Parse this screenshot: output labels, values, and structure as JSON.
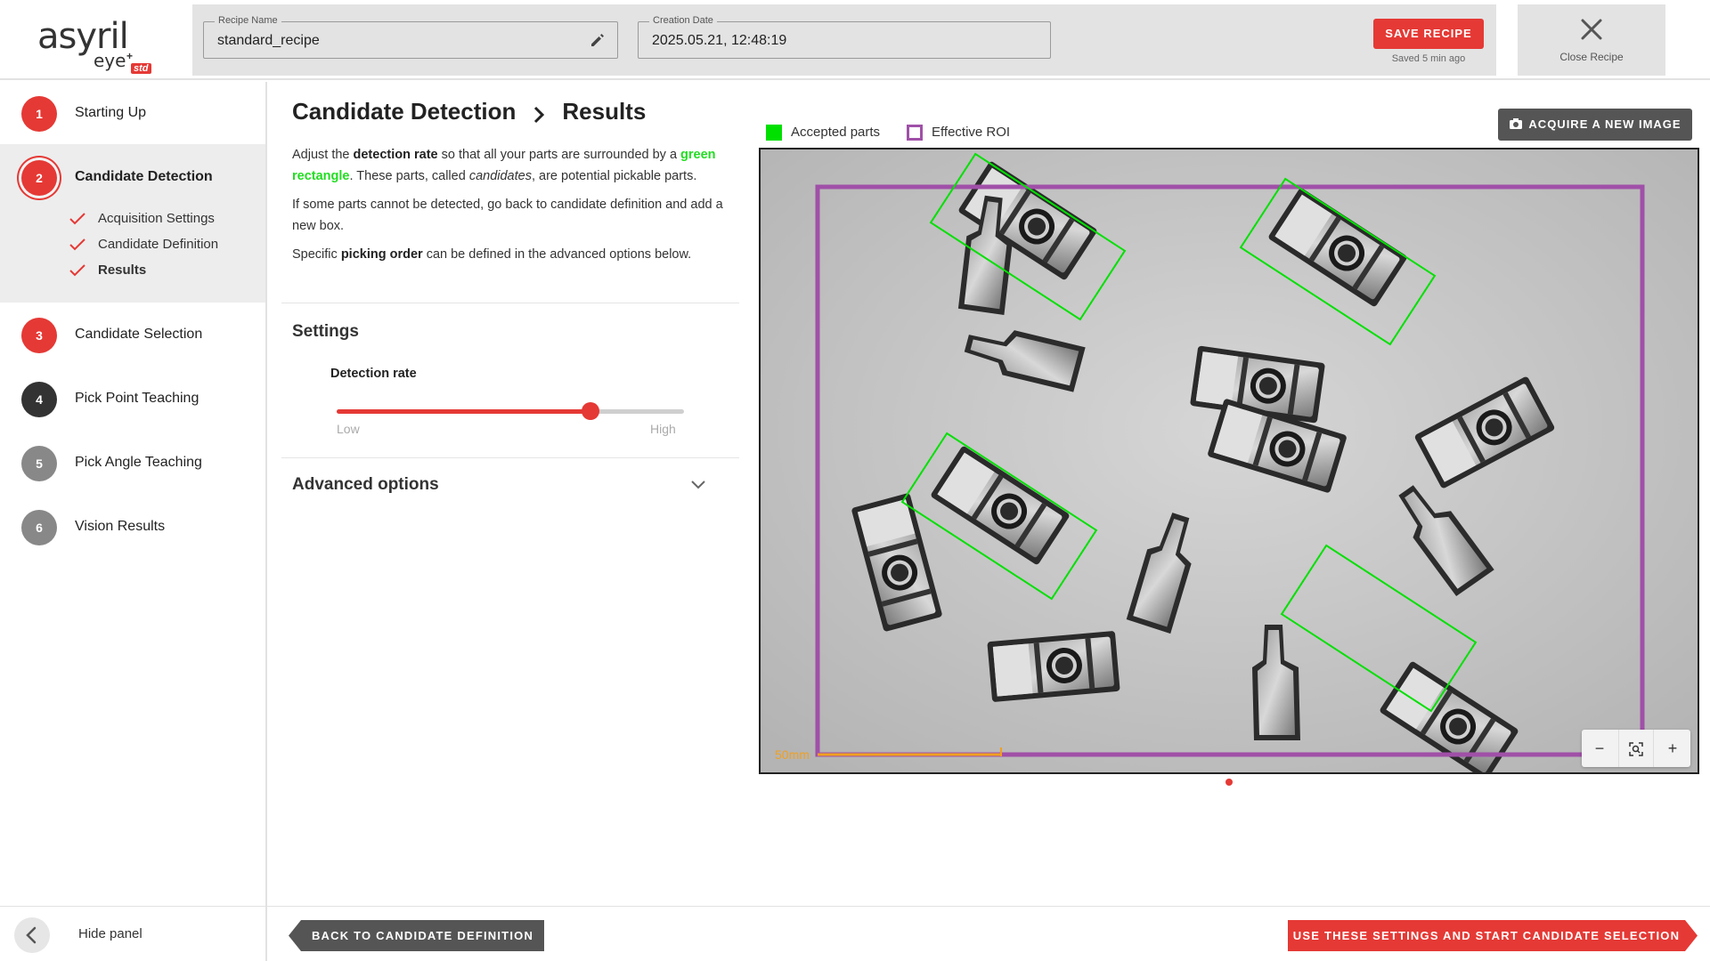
{
  "logo": {
    "word": "asyril",
    "sub": "eye",
    "sup": "+",
    "badge": "std"
  },
  "header": {
    "recipe_name_label": "Recipe Name",
    "recipe_name_value": "standard_recipe",
    "creation_date_label": "Creation Date",
    "creation_date_value": "2025.05.21, 12:48:19",
    "save_label": "SAVE RECIPE",
    "saved_note": "Saved 5 min ago",
    "close_label": "Close Recipe"
  },
  "sidebar": {
    "steps": [
      {
        "num": "1",
        "label": "Starting Up"
      },
      {
        "num": "2",
        "label": "Candidate Detection"
      },
      {
        "num": "3",
        "label": "Candidate Selection"
      },
      {
        "num": "4",
        "label": "Pick Point Teaching"
      },
      {
        "num": "5",
        "label": "Pick Angle Teaching"
      },
      {
        "num": "6",
        "label": "Vision Results"
      }
    ],
    "substeps": [
      {
        "label": "Acquisition Settings"
      },
      {
        "label": "Candidate Definition"
      },
      {
        "label": "Results"
      }
    ],
    "hide_panel": "Hide panel"
  },
  "main": {
    "breadcrumb": [
      "Candidate Detection",
      "Results"
    ],
    "desc": {
      "p1_a": "Adjust the ",
      "p1_b": "detection rate",
      "p1_c": " so that all your parts are surrounded by a ",
      "p1_d": "green rectangle",
      "p1_e": ". These parts, called ",
      "p1_f": "candidates",
      "p1_g": ", are potential pickable parts.",
      "p2": "If some parts cannot be detected, go back to candidate definition and add a new box.",
      "p3_a": "Specific ",
      "p3_b": "picking order",
      "p3_c": " can be defined in the advanced options below."
    },
    "settings_title": "Settings",
    "detection_rate_label": "Detection rate",
    "detection_rate_value": 0.73,
    "slider_low": "Low",
    "slider_high": "High",
    "advanced_title": "Advanced options"
  },
  "image": {
    "legend": [
      {
        "label": "Accepted parts",
        "color": "#00e000"
      },
      {
        "label": "Effective ROI",
        "color": "#a050a8"
      }
    ],
    "acquire_label": "ACQUIRE A NEW IMAGE",
    "scale_label": "50mm",
    "zoom_minus": "−",
    "zoom_plus": "+"
  },
  "footer": {
    "back_label": "BACK TO CANDIDATE DEFINITION",
    "next_label": "USE THESE SETTINGS AND START CANDIDATE SELECTION"
  },
  "colors": {
    "accent": "#e53935",
    "accepted": "#00e000",
    "roi": "#a050a8"
  }
}
